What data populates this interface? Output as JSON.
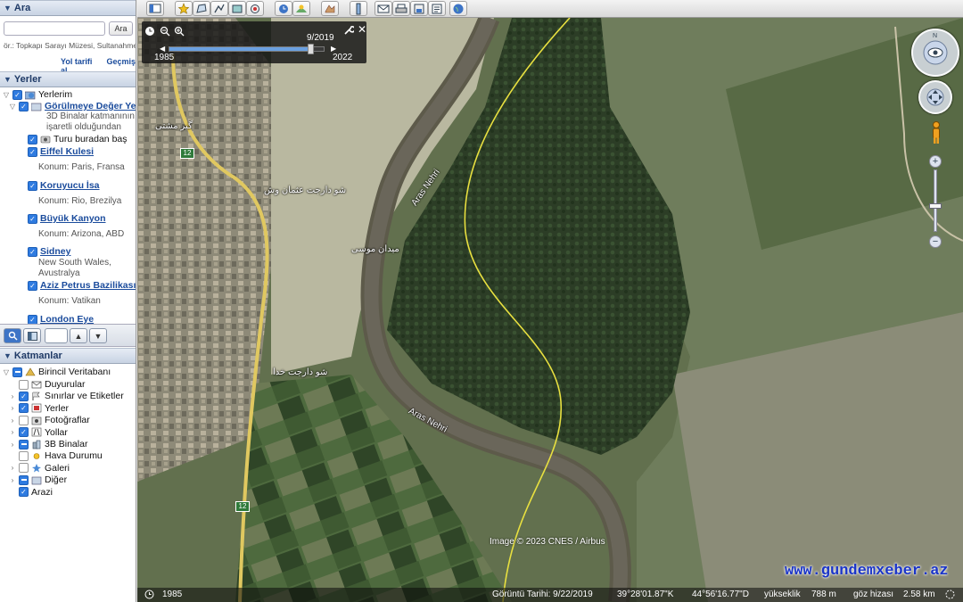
{
  "search": {
    "title": "Ara",
    "input_value": "",
    "button_label": "Ara",
    "hint": "ör.: Topkapı Sarayı Müzesi, Sultanahmet",
    "directions_link": "Yol tarifi al",
    "history_link": "Geçmiş"
  },
  "places": {
    "title": "Yerler",
    "root": "Yerlerim",
    "folder": "Görülmeye Değer Yerler",
    "folder_desc_1": "3D Binalar katmanının",
    "folder_desc_2": "işaretli olduğundan",
    "tour": "Turu buradan başlatın",
    "items": [
      {
        "name": "Eiffel Kulesi",
        "loc": "Konum: Paris, Fransa"
      },
      {
        "name": "Koruyucu İsa",
        "loc": "Konum: Rio, Brezilya"
      },
      {
        "name": "Büyük Kanyon",
        "loc": "Konum: Arizona, ABD"
      },
      {
        "name": "Sidney",
        "loc": "New South Wales,",
        "loc2": "Avustralya"
      },
      {
        "name": "Aziz Petrus Bazilikası",
        "loc": "Konum: Vatikan"
      },
      {
        "name": "London Eye",
        "loc": ""
      }
    ]
  },
  "layers": {
    "title": "Katmanlar",
    "root": "Birincil Veritabanı",
    "items": [
      {
        "label": "Duyurular",
        "state": "off",
        "icon": "envelope-icon"
      },
      {
        "label": "Sınırlar ve Etiketler",
        "state": "on",
        "icon": "flag-icon"
      },
      {
        "label": "Yerler",
        "state": "on",
        "icon": "place-icon"
      },
      {
        "label": "Fotoğraflar",
        "state": "off",
        "icon": "photo-icon"
      },
      {
        "label": "Yollar",
        "state": "on",
        "icon": "road-icon"
      },
      {
        "label": "3B Binalar",
        "state": "partial",
        "icon": "building-icon"
      },
      {
        "label": "Hava Durumu",
        "state": "off",
        "icon": "weather-icon"
      },
      {
        "label": "Galeri",
        "state": "off",
        "icon": "gallery-icon"
      },
      {
        "label": "Diğer",
        "state": "partial",
        "icon": "other-icon"
      },
      {
        "label": "Arazi",
        "state": "on",
        "icon": ""
      }
    ]
  },
  "time_slider": {
    "current": "9/2019",
    "start": "1985",
    "end": "2022",
    "position_fraction": 0.9
  },
  "map": {
    "river_label_1": "Aras Nehri",
    "river_label_2": "Aras Nehri",
    "road_shield": "12",
    "arabic_label_1": "شو دارجت عثمان وش",
    "arabic_label_2": "میدان موسی",
    "arabic_label_3": "شو دارجت خدا",
    "arabic_label_4": "گیر مشتی",
    "copyright": "Image © 2023 CNES / Airbus",
    "watermark": "www.gundemxeber.az"
  },
  "status": {
    "history_year": "1985",
    "imagery_date": "Görüntü Tarihi: 9/22/2019",
    "lat": "39°28'01.87\"K",
    "lon": "44°56'16.77\"D",
    "elev_label": "yükseklik",
    "elev": "788 m",
    "eye_label": "göz hizası",
    "eye": "2.58 km"
  },
  "colors": {
    "accent": "#2f7be0",
    "border_line": "#e8e040",
    "link": "#1a4b9c"
  }
}
